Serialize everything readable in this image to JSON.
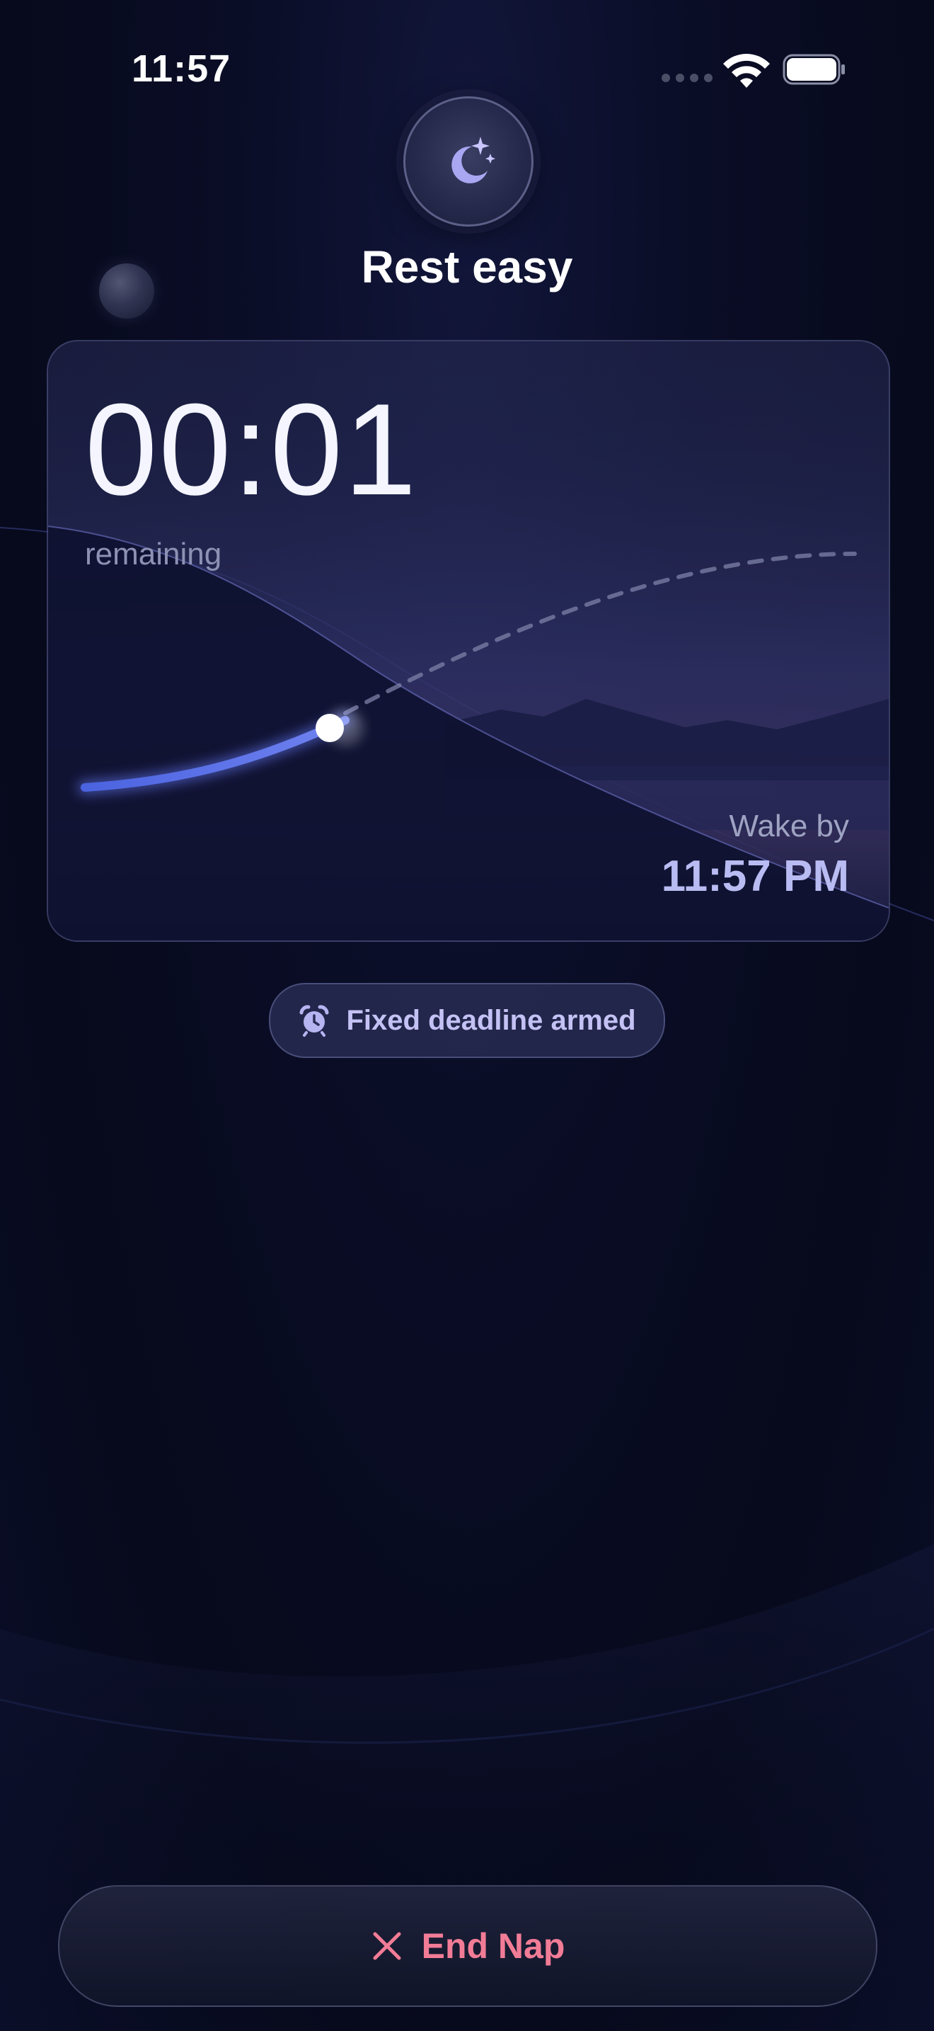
{
  "status_bar": {
    "time": "11:57"
  },
  "header": {
    "title": "Rest easy",
    "icon": "moon-stars-icon"
  },
  "timer": {
    "countdown": "00:01",
    "remaining_label": "remaining",
    "wake_label": "Wake by",
    "wake_time": "11:57 PM",
    "progress": 0.45
  },
  "deadline_pill": {
    "label": "Fixed deadline armed",
    "icon": "alarm-clock-icon"
  },
  "actions": {
    "end_label": "End Nap",
    "end_icon": "close-icon"
  },
  "colors": {
    "accent": "#5b6ee1",
    "pill_text": "#c4c2f4",
    "end_text": "#f27c96",
    "wake_time": "#b9bcf2"
  }
}
